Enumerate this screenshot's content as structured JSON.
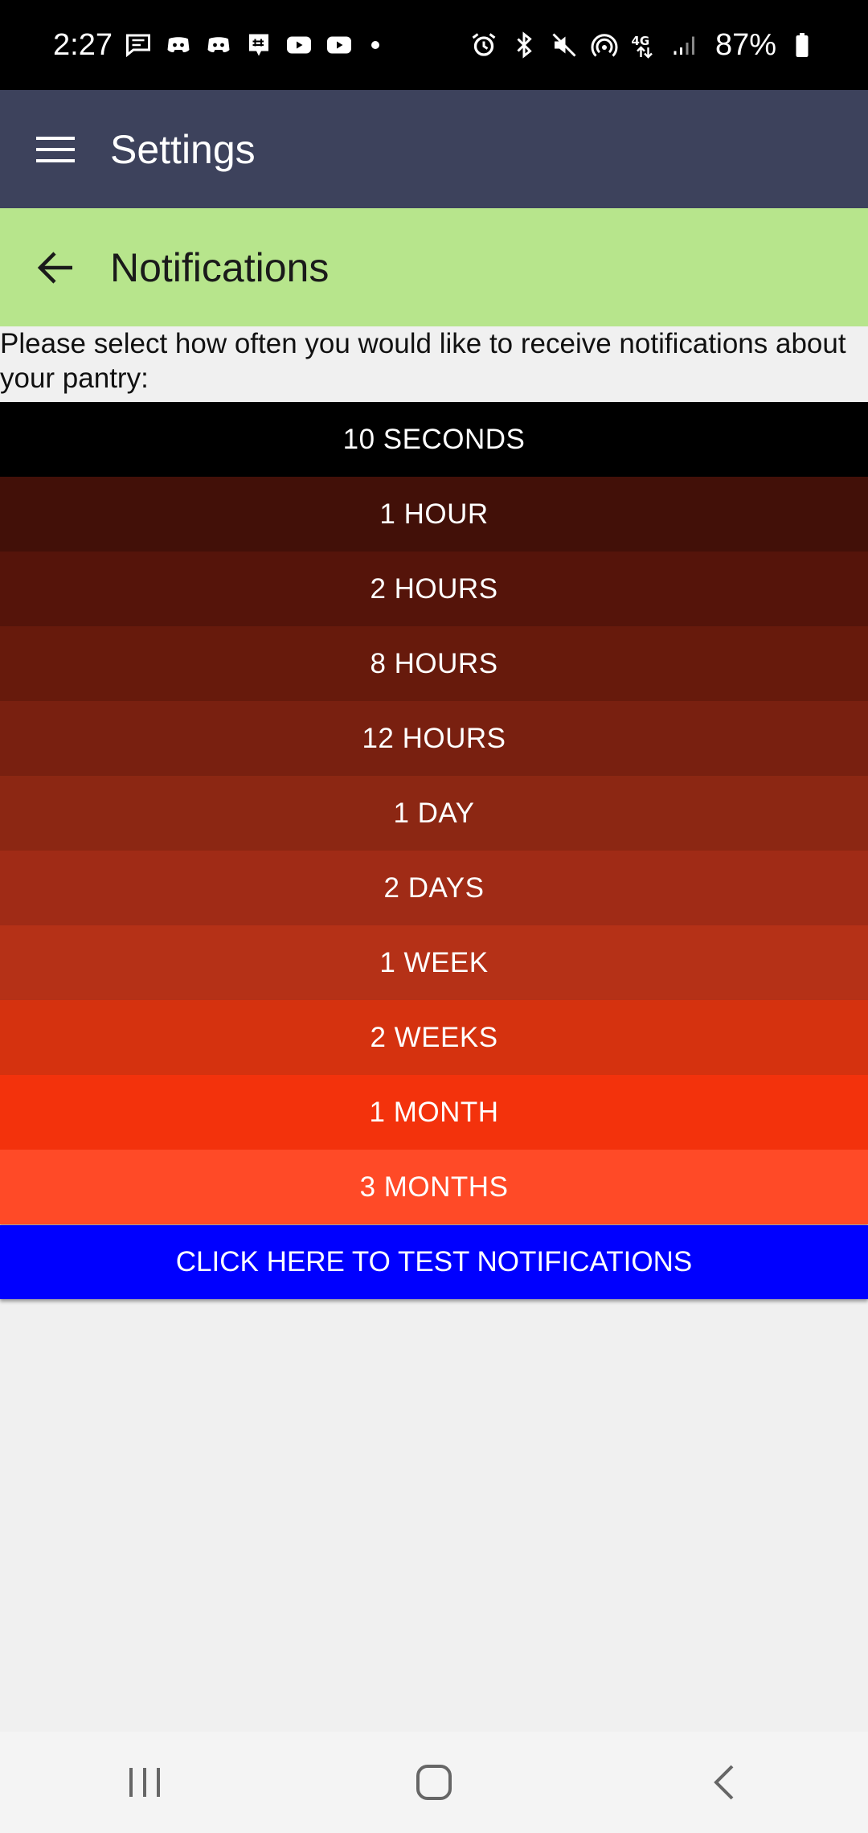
{
  "status_bar": {
    "time": "2:27",
    "battery": "87%",
    "left_icons": [
      "message-icon",
      "discord-icon",
      "discord-icon",
      "groupme-icon",
      "youtube-icon",
      "youtube-icon"
    ],
    "right_icons": [
      "alarm-icon",
      "bluetooth-icon",
      "mute-icon",
      "hotspot-icon",
      "lte-icon",
      "signal-icon"
    ]
  },
  "app_bar": {
    "title": "Settings",
    "background": "#3d425c"
  },
  "sub_bar": {
    "title": "Notifications",
    "background": "#b7e58c"
  },
  "description": "Please select how often you would like to receive notifications about your pantry:",
  "options": [
    {
      "label": "10 SECONDS",
      "color": "#000000"
    },
    {
      "label": "1 HOUR",
      "color": "#421008"
    },
    {
      "label": "2 HOURS",
      "color": "#55140a"
    },
    {
      "label": "8 HOURS",
      "color": "#671a0c"
    },
    {
      "label": "12 HOURS",
      "color": "#792010"
    },
    {
      "label": "1 DAY",
      "color": "#8c2713"
    },
    {
      "label": "2 DAYS",
      "color": "#a02b16"
    },
    {
      "label": "1 WEEK",
      "color": "#b53117"
    },
    {
      "label": "2 WEEKS",
      "color": "#d5320f"
    },
    {
      "label": "1 MONTH",
      "color": "#f3320c"
    },
    {
      "label": "3 MONTHS",
      "color": "#ff4a27"
    }
  ],
  "test_button": {
    "label": "CLICK HERE TO TEST NOTIFICATIONS",
    "color": "#0000ff"
  }
}
